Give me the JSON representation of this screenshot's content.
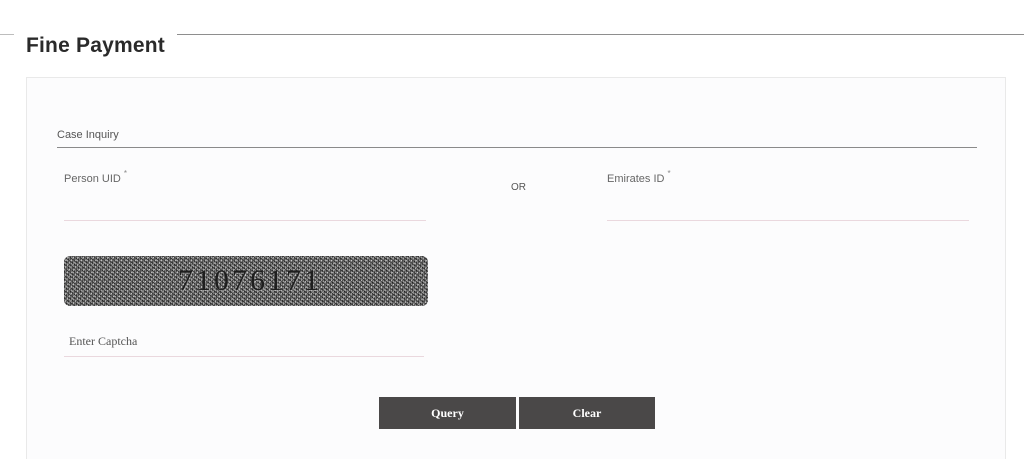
{
  "page": {
    "title": "Fine Payment"
  },
  "form": {
    "section_label": "Case Inquiry",
    "person_uid": {
      "label": "Person UID",
      "required_mark": "*",
      "value": ""
    },
    "separator": "OR",
    "emirates_id": {
      "label": "Emirates ID",
      "required_mark": "*",
      "value": ""
    },
    "captcha": {
      "code": "71076171",
      "input_placeholder": "Enter Captcha",
      "input_value": ""
    },
    "buttons": {
      "query_label": "Query",
      "clear_label": "Clear"
    }
  },
  "colors": {
    "button_bg": "#4a4848",
    "button_text": "#ffffff",
    "section_rule": "#8a8a8a",
    "input_underline": "#ead8de"
  }
}
